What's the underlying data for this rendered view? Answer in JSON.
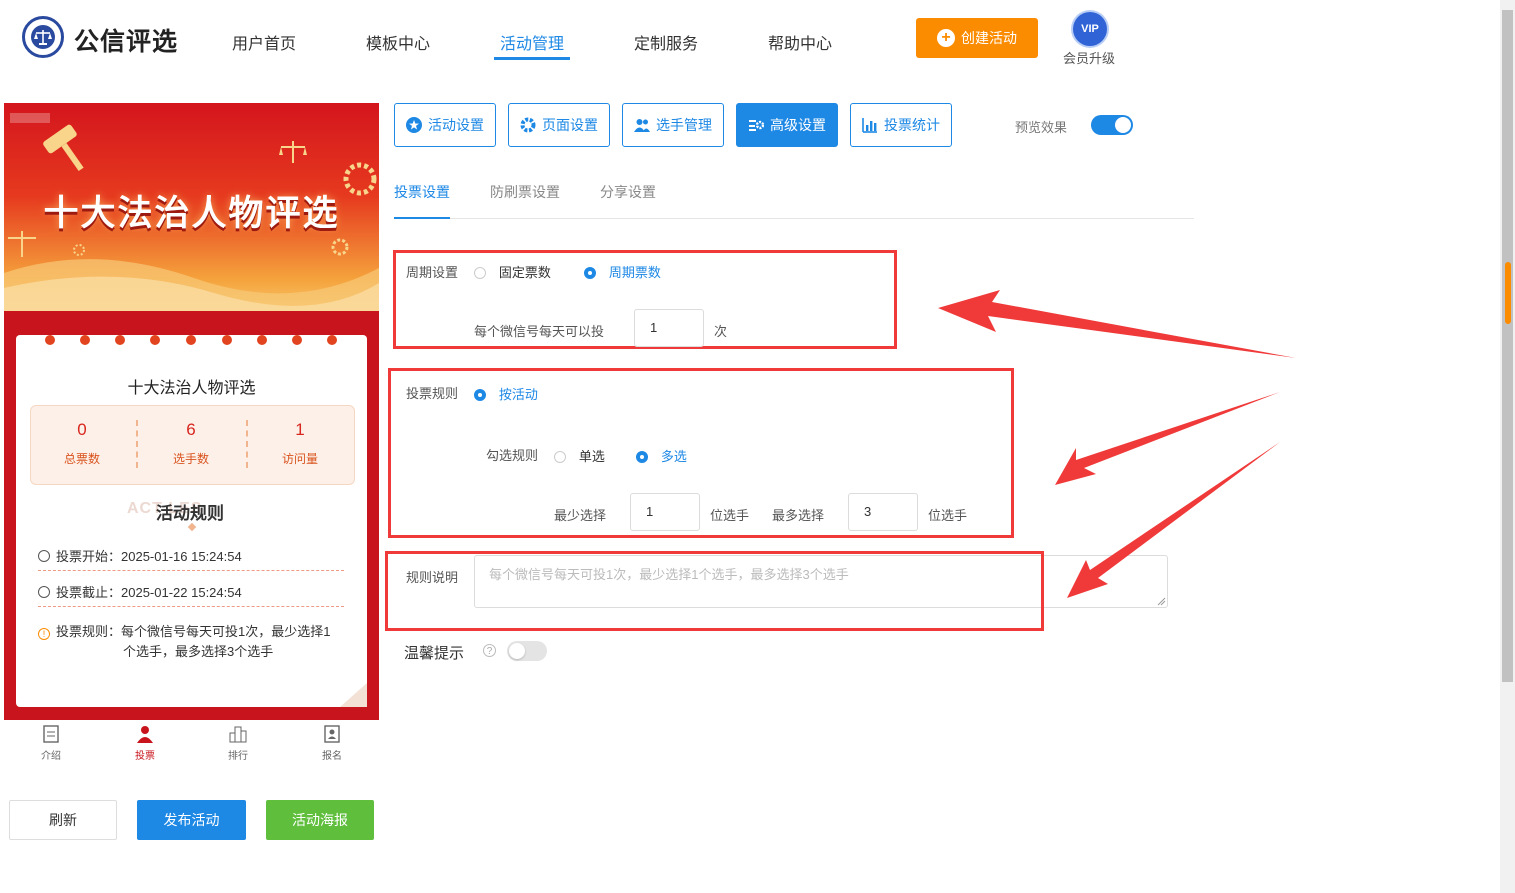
{
  "header": {
    "logo_text": "公信评选",
    "nav": [
      "用户首页",
      "模板中心",
      "活动管理",
      "定制服务",
      "帮助中心"
    ],
    "active_nav": "活动管理",
    "create_label": "创建活动",
    "vip_badge": "VIP",
    "vip_label": "会员升级"
  },
  "preview": {
    "banner_title": "十大法治人物评选",
    "card_title": "十大法治人物评选",
    "stats": [
      {
        "value": "0",
        "label": "总票数"
      },
      {
        "value": "6",
        "label": "选手数"
      },
      {
        "value": "1",
        "label": "访问量"
      }
    ],
    "rules_ghost": "ACT          LES",
    "rules_title": "活动规则",
    "vote_start": "投票开始：2025-01-16 15:24:54",
    "vote_end": "投票截止：2025-01-22 15:24:54",
    "vote_rule_line1": "投票规则：每个微信号每天可投1次，最少选择1",
    "vote_rule_line2": "个选手，最多选择3个选手",
    "tabbar": [
      "介绍",
      "投票",
      "排行",
      "报名"
    ],
    "active_tab": "投票"
  },
  "actions": {
    "refresh": "刷新",
    "publish": "发布活动",
    "poster": "活动海报"
  },
  "toolbar": {
    "buttons": [
      "活动设置",
      "页面设置",
      "选手管理",
      "高级设置",
      "投票统计"
    ],
    "active": "高级设置",
    "preview_label": "预览效果",
    "preview_on": true
  },
  "subtabs": [
    "投票设置",
    "防刷票设置",
    "分享设置"
  ],
  "active_subtab": "投票设置",
  "form": {
    "cycle_label": "周期设置",
    "cycle_options": [
      "固定票数",
      "周期票数"
    ],
    "cycle_selected": "周期票数",
    "daily_label": "每个微信号每天可以投",
    "daily_value": "1",
    "daily_unit": "次",
    "rule_label": "投票规则",
    "rule_option": "按活动",
    "select_rule_label": "勾选规则",
    "select_options": [
      "单选",
      "多选"
    ],
    "select_selected": "多选",
    "min_label": "最少选择",
    "min_value": "1",
    "min_unit": "位选手",
    "max_label": "最多选择",
    "max_value": "3",
    "max_unit": "位选手",
    "desc_label": "规则说明",
    "desc_placeholder": "每个微信号每天可投1次，最少选择1个选手，最多选择3个选手",
    "tip_label": "温馨提示",
    "tip_on": false
  },
  "colors": {
    "accent": "#1e88e5",
    "orange": "#fb8c00",
    "green": "#5fbf3d",
    "highlight": "#f03a3a"
  }
}
